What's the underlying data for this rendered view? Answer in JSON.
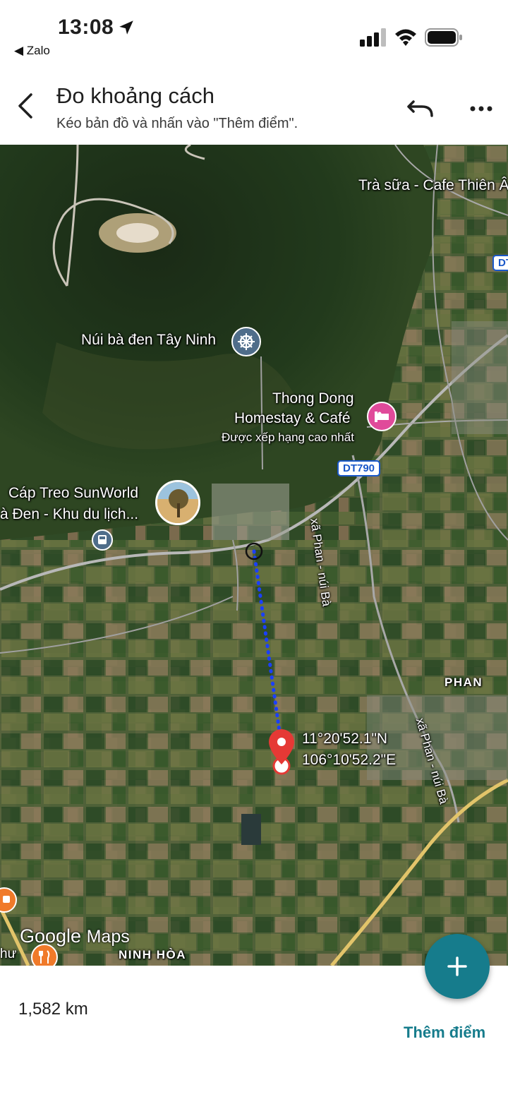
{
  "status_bar": {
    "time": "13:08",
    "back_app": "◀ Zalo"
  },
  "header": {
    "title": "Đo khoảng cách",
    "subtitle": "Kéo bản đồ và nhấn vào \"Thêm điểm\"."
  },
  "map": {
    "labels": {
      "tra_sua": "Trà sữa - Cafe Thiên Â",
      "nui_ba_den": "Núi bà đen Tây Ninh",
      "homestay_line1": "Thong Dong",
      "homestay_line2": "Homestay & Café",
      "homestay_rating": "Được xếp hạng cao nhất",
      "cap_treo_line1": "Cáp Treo SunWorld",
      "cap_treo_line2": "à Đen - Khu du lịch...",
      "road_xa_phan_1": "xã Phan - núi Bà",
      "road_xa_phan_2": "xã Phan - núi Bà",
      "phan": "PHAN",
      "ninh_hoa": "NINH HÒA",
      "thu": "hư"
    },
    "road_badges": {
      "dt790": "DT790",
      "dt_edge": "DT"
    },
    "coordinates": {
      "lat": "11°20'52.1\"N",
      "lng": "106°10'52.2\"E"
    },
    "attribution": {
      "google": "Google",
      "maps": "Maps"
    }
  },
  "bottom": {
    "distance": "1,582 km",
    "add_point": "Thêm điểm"
  },
  "colors": {
    "accent": "#167c8c",
    "pin": "#e53935",
    "measure_line": "#1a3fff",
    "road_badge": "#1a58c9"
  }
}
